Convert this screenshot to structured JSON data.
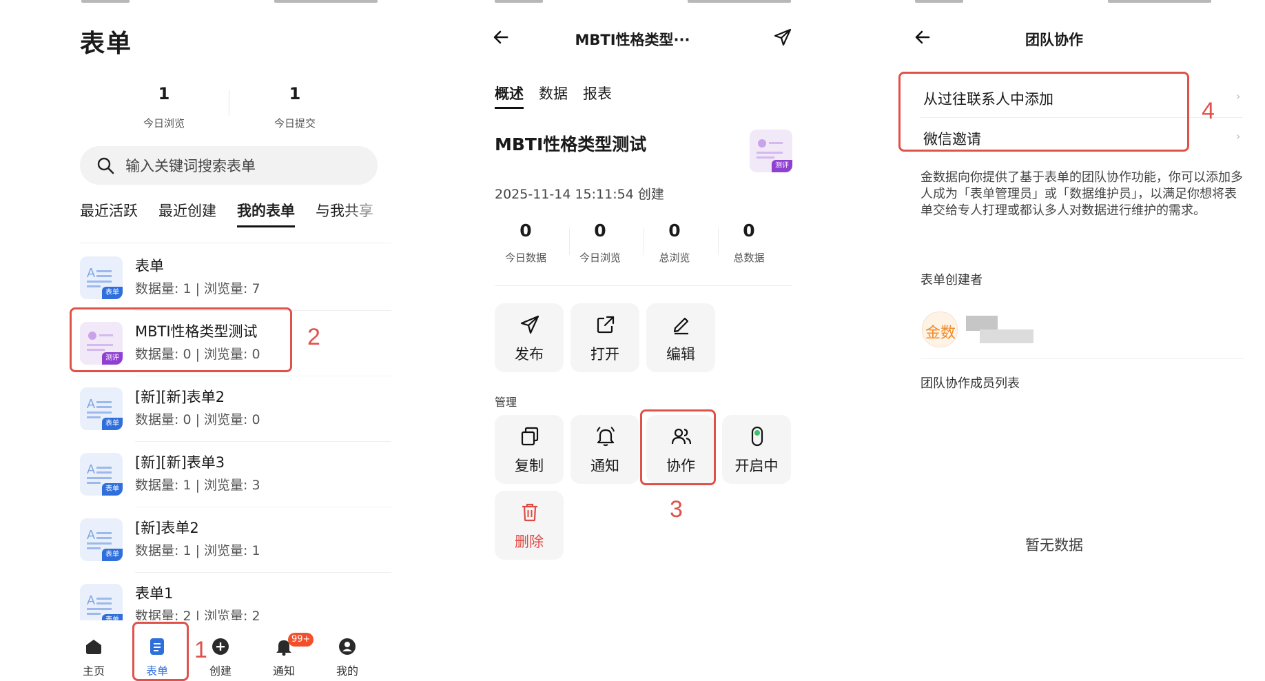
{
  "colors": {
    "accent": "#2f6fdc",
    "annotation": "#e0514a",
    "danger": "#e04a44",
    "badge_purple": "#8f3fd1",
    "notif": "#f24f2a"
  },
  "panel1": {
    "title": "表单",
    "stats": [
      {
        "value": "1",
        "label": "今日浏览"
      },
      {
        "value": "1",
        "label": "今日提交"
      }
    ],
    "search": {
      "placeholder": "输入关键词搜索表单",
      "icon": "search-icon"
    },
    "tabs": [
      {
        "label": "最近活跃",
        "active": false
      },
      {
        "label": "最近创建",
        "active": false
      },
      {
        "label": "我的表单",
        "active": true
      },
      {
        "label": "与我共享",
        "active": false
      }
    ],
    "forms": [
      {
        "name": "表单",
        "meta": "数据量: 1 | 浏览量: 7",
        "badge": "表单"
      },
      {
        "name": "MBTI性格类型测试",
        "meta": "数据量: 0 | 浏览量: 0",
        "badge": "测评"
      },
      {
        "name": "[新][新]表单2",
        "meta": "数据量: 0 | 浏览量: 0",
        "badge": "表单"
      },
      {
        "name": "[新][新]表单3",
        "meta": "数据量: 1 | 浏览量: 3",
        "badge": "表单"
      },
      {
        "name": "[新]表单2",
        "meta": "数据量: 1 | 浏览量: 1",
        "badge": "表单"
      },
      {
        "name": "表单1",
        "meta": "数据量: 2 | 浏览量: 2",
        "badge": "表单"
      }
    ],
    "nav": [
      {
        "label": "主页",
        "icon": "home-icon"
      },
      {
        "label": "表单",
        "icon": "form-icon",
        "active": true
      },
      {
        "label": "创建",
        "icon": "plus-circle-icon"
      },
      {
        "label": "通知",
        "icon": "bell-icon",
        "badge": "99+"
      },
      {
        "label": "我的",
        "icon": "user-icon"
      }
    ]
  },
  "panel2": {
    "header_title": "MBTI性格类型···",
    "tabs": [
      {
        "label": "概述",
        "active": true
      },
      {
        "label": "数据",
        "active": false
      },
      {
        "label": "报表",
        "active": false
      }
    ],
    "title": "MBTI性格类型测试",
    "created": "2025-11-14 15:11:54 创建",
    "icon_badge": "测评",
    "stats": [
      {
        "value": "0",
        "label": "今日数据"
      },
      {
        "value": "0",
        "label": "今日浏览"
      },
      {
        "value": "0",
        "label": "总浏览"
      },
      {
        "value": "0",
        "label": "总数据"
      }
    ],
    "actions": [
      {
        "label": "发布",
        "icon": "send-icon"
      },
      {
        "label": "打开",
        "icon": "external-link-icon"
      },
      {
        "label": "编辑",
        "icon": "pencil-icon"
      }
    ],
    "manage_label": "管理",
    "manage": [
      {
        "label": "复制",
        "icon": "copy-icon"
      },
      {
        "label": "通知",
        "icon": "bell-icon"
      },
      {
        "label": "协作",
        "icon": "users-icon"
      },
      {
        "label": "开启中",
        "icon": "toggle-icon"
      },
      {
        "label": "删除",
        "icon": "trash-icon"
      }
    ]
  },
  "panel3": {
    "header_title": "团队协作",
    "options": [
      {
        "label": "从过往联系人中添加"
      },
      {
        "label": "微信邀请"
      }
    ],
    "description": "金数据向你提供了基于表单的团队协作功能，你可以添加多人成为「表单管理员」或「数据维护员」，以满足你想将表单交给专人打理或都认多人对数据进行维护的需求。",
    "creator_label": "表单创建者",
    "avatar_text": "金数",
    "members_label": "团队协作成员列表",
    "empty": "暂无数据"
  },
  "annotations": [
    "1",
    "2",
    "3",
    "4"
  ]
}
